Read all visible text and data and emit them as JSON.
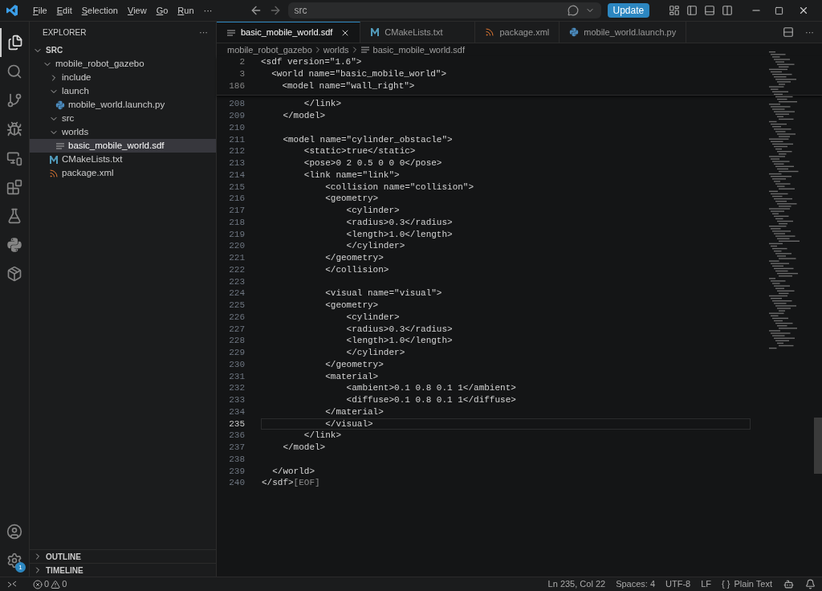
{
  "menu": [
    "File",
    "Edit",
    "Selection",
    "View",
    "Go",
    "Run",
    "···"
  ],
  "command_center": {
    "value": "src"
  },
  "update_button": "Update",
  "explorer": {
    "title": "EXPLORER",
    "more": "···",
    "section": {
      "label": "SRC",
      "expanded": true
    },
    "tree": [
      {
        "label": "mobile_robot_gazebo",
        "kind": "folder",
        "expanded": true,
        "selected": false,
        "children": [
          {
            "label": "include",
            "kind": "folder",
            "expanded": false,
            "selected": false
          },
          {
            "label": "launch",
            "kind": "folder",
            "expanded": true,
            "selected": false,
            "children": [
              {
                "label": "mobile_world.launch.py",
                "kind": "python",
                "selected": false
              }
            ]
          },
          {
            "label": "src",
            "kind": "folder",
            "expanded": true,
            "selected": false
          },
          {
            "label": "worlds",
            "kind": "folder",
            "expanded": true,
            "selected": false,
            "children": [
              {
                "label": "basic_mobile_world.sdf",
                "kind": "text",
                "selected": true
              }
            ]
          },
          {
            "label": "CMakeLists.txt",
            "kind": "cmake",
            "selected": false
          },
          {
            "label": "package.xml",
            "kind": "xml",
            "selected": false
          }
        ]
      }
    ],
    "panels": [
      {
        "label": "OUTLINE",
        "expanded": false
      },
      {
        "label": "TIMELINE",
        "expanded": false
      }
    ]
  },
  "tabs": [
    {
      "label": "basic_mobile_world.sdf",
      "kind": "text",
      "selected": true
    },
    {
      "label": "CMakeLists.txt",
      "kind": "cmake",
      "selected": false
    },
    {
      "label": "package.xml",
      "kind": "xml",
      "selected": false
    },
    {
      "label": "mobile_world.launch.py",
      "kind": "python",
      "selected": false
    }
  ],
  "breadcrumbs": [
    {
      "label": "mobile_robot_gazebo",
      "kind": "folder"
    },
    {
      "label": "worlds",
      "kind": "folder"
    },
    {
      "label": "basic_mobile_world.sdf",
      "kind": "text"
    }
  ],
  "sticky_lines": [
    {
      "number": "2",
      "text": "<sdf version=\"1.6\">"
    },
    {
      "number": "3",
      "text": "  <world name=\"basic_mobile_world\">"
    },
    {
      "number": "186",
      "text": "    <model name=\"wall_right\">"
    }
  ],
  "lines": [
    {
      "number": "208",
      "text": "        </link>",
      "selected": false
    },
    {
      "number": "209",
      "text": "    </model>",
      "selected": false
    },
    {
      "number": "210",
      "selected": false
    },
    {
      "number": "211",
      "text": "    <model name=\"cylinder_obstacle\">",
      "selected": false
    },
    {
      "number": "212",
      "text": "        <static>true</static>",
      "selected": false
    },
    {
      "number": "213",
      "text": "        <pose>0 2 0.5 0 0 0</pose>",
      "selected": false
    },
    {
      "number": "214",
      "text": "        <link name=\"link\">",
      "selected": false
    },
    {
      "number": "215",
      "text": "            <collision name=\"collision\">",
      "selected": false
    },
    {
      "number": "216",
      "text": "            <geometry>",
      "selected": false
    },
    {
      "number": "217",
      "text": "                <cylinder>",
      "selected": false
    },
    {
      "number": "218",
      "text": "                <radius>0.3</radius>",
      "selected": false
    },
    {
      "number": "219",
      "text": "                <length>1.0</length>",
      "selected": false
    },
    {
      "number": "220",
      "text": "                </cylinder>",
      "selected": false
    },
    {
      "number": "221",
      "text": "            </geometry>",
      "selected": false
    },
    {
      "number": "222",
      "text": "            </collision>",
      "selected": false
    },
    {
      "number": "223",
      "selected": false
    },
    {
      "number": "224",
      "text": "            <visual name=\"visual\">",
      "selected": false
    },
    {
      "number": "225",
      "text": "            <geometry>",
      "selected": false
    },
    {
      "number": "226",
      "text": "                <cylinder>",
      "selected": false
    },
    {
      "number": "227",
      "text": "                <radius>0.3</radius>",
      "selected": false
    },
    {
      "number": "228",
      "text": "                <length>1.0</length>",
      "selected": false
    },
    {
      "number": "229",
      "text": "                </cylinder>",
      "selected": false
    },
    {
      "number": "230",
      "text": "            </geometry>",
      "selected": false
    },
    {
      "number": "231",
      "text": "            <material>",
      "selected": false
    },
    {
      "number": "232",
      "text": "                <ambient>0.1 0.8 0.1 1</ambient>",
      "selected": false
    },
    {
      "number": "233",
      "text": "                <diffuse>0.1 0.8 0.1 1</diffuse>",
      "selected": false
    },
    {
      "number": "234",
      "text": "            </material>",
      "selected": false
    },
    {
      "number": "235",
      "text": "            </visual>",
      "selected": true
    },
    {
      "number": "236",
      "text": "        </link>",
      "selected": false
    },
    {
      "number": "237",
      "text": "    </model>",
      "selected": false
    },
    {
      "number": "238",
      "selected": false
    },
    {
      "number": "239",
      "text": "  </world>",
      "selected": false
    },
    {
      "number": "240",
      "text": "</sdf>",
      "eof": "[EOF]",
      "selected": false
    }
  ],
  "settings_badge": "1",
  "status_bar": {
    "errors": "0",
    "warnings": "0",
    "items": [
      "Ln 235, Col 22",
      "Spaces: 4",
      "UTF-8",
      "LF"
    ],
    "language": "Plain Text",
    "language_prefix": "{ }"
  }
}
